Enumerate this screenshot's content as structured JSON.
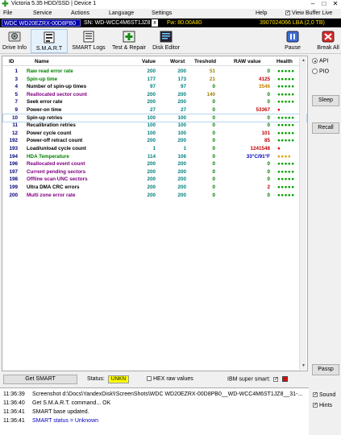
{
  "titlebar": {
    "title": "Victoria 5.35 HDD/SSD | Device 1",
    "icon": "green-cross-icon",
    "controls": [
      "–",
      "□",
      "✕"
    ]
  },
  "menu": {
    "items": [
      "File",
      "Service",
      "Actions",
      "Language",
      "Settings",
      "Help"
    ],
    "view_buffer_live": "View Buffer Live",
    "view_buffer_checked": true
  },
  "infobar": {
    "model": "WDC WD20EZRX-00D8PB0",
    "serial": "SN: WD-WCC4M6ST1JZ8",
    "close": "x",
    "firmware": "Fw: 80.00A80",
    "lba": "3907024066 LBA (2,0 TB)"
  },
  "toolbar": {
    "drive_info": "Drive Info",
    "smart": "S.M.A.R.T",
    "smart_logs": "SMART Logs",
    "test_repair": "Test & Repair",
    "disk_editor": "Disk Editor",
    "pause": "Pause",
    "break_all": "Break All"
  },
  "smart_table": {
    "headers": [
      "ID",
      "Name",
      "Value",
      "Worst",
      "Treshold",
      "RAW value",
      "Health"
    ],
    "rows": [
      {
        "id": "1",
        "name": "Raw read error rate",
        "value": "200",
        "worst": "200",
        "threshold": "51",
        "raw": "0",
        "health": "●●●●●",
        "name_color": "#008000",
        "raw_color": "#008000",
        "health_color": "#00a000"
      },
      {
        "id": "3",
        "name": "Spin-up time",
        "value": "177",
        "worst": "173",
        "threshold": "21",
        "raw": "4125",
        "health": "●●●●●",
        "name_color": "#008000",
        "raw_color": "#c00000",
        "health_color": "#00a000"
      },
      {
        "id": "4",
        "name": "Number of spin-up times",
        "value": "97",
        "worst": "97",
        "threshold": "0",
        "raw": "3546",
        "health": "●●●●●",
        "name_color": "#000000",
        "raw_color": "#c08000",
        "health_color": "#00a000"
      },
      {
        "id": "5",
        "name": "Reallocated sector count",
        "value": "200",
        "worst": "200",
        "threshold": "140",
        "raw": "0",
        "health": "●●●●●",
        "name_color": "#800080",
        "raw_color": "#008000",
        "health_color": "#00a000"
      },
      {
        "id": "7",
        "name": "Seek error rate",
        "value": "200",
        "worst": "200",
        "threshold": "0",
        "raw": "0",
        "health": "●●●●●",
        "name_color": "#000000",
        "raw_color": "#008000",
        "health_color": "#00a000"
      },
      {
        "id": "9",
        "name": "Power-on time",
        "value": "27",
        "worst": "27",
        "threshold": "0",
        "raw": "53367",
        "health": "●",
        "name_color": "#000000",
        "raw_color": "#c00000",
        "health_color": "#e00000"
      },
      {
        "id": "10",
        "name": "Spin-up retries",
        "value": "100",
        "worst": "100",
        "threshold": "0",
        "raw": "0",
        "health": "●●●●●",
        "name_color": "#000000",
        "raw_color": "#008000",
        "health_color": "#00a000"
      },
      {
        "id": "11",
        "name": "Recalibration retries",
        "value": "100",
        "worst": "100",
        "threshold": "0",
        "raw": "0",
        "health": "●●●●●",
        "name_color": "#000000",
        "raw_color": "#008000",
        "health_color": "#00a000"
      },
      {
        "id": "12",
        "name": "Power cycle count",
        "value": "100",
        "worst": "100",
        "threshold": "0",
        "raw": "101",
        "health": "●●●●●",
        "name_color": "#000000",
        "raw_color": "#c00000",
        "health_color": "#00a000"
      },
      {
        "id": "192",
        "name": "Power-off retract count",
        "value": "200",
        "worst": "200",
        "threshold": "0",
        "raw": "85",
        "health": "●●●●●",
        "name_color": "#000000",
        "raw_color": "#c00000",
        "health_color": "#00a000"
      },
      {
        "id": "193",
        "name": "Load/unload cycle count",
        "value": "1",
        "worst": "1",
        "threshold": "0",
        "raw": "1241548",
        "health": "●",
        "name_color": "#000000",
        "raw_color": "#c00000",
        "health_color": "#e00000"
      },
      {
        "id": "194",
        "name": "HDA Temperature",
        "value": "114",
        "worst": "106",
        "threshold": "0",
        "raw": "33°C/91°F",
        "health": "●●●●",
        "name_color": "#008000",
        "raw_color": "#0000c0",
        "health_color": "#e0a000"
      },
      {
        "id": "196",
        "name": "Reallocated event count",
        "value": "200",
        "worst": "200",
        "threshold": "0",
        "raw": "0",
        "health": "●●●●●",
        "name_color": "#800080",
        "raw_color": "#008000",
        "health_color": "#00a000"
      },
      {
        "id": "197",
        "name": "Current pending sectors",
        "value": "200",
        "worst": "200",
        "threshold": "0",
        "raw": "0",
        "health": "●●●●●",
        "name_color": "#800080",
        "raw_color": "#008000",
        "health_color": "#00a000"
      },
      {
        "id": "198",
        "name": "Offline scan UNC sectors",
        "value": "200",
        "worst": "200",
        "threshold": "0",
        "raw": "0",
        "health": "●●●●●",
        "name_color": "#800080",
        "raw_color": "#008000",
        "health_color": "#00a000"
      },
      {
        "id": "199",
        "name": "Ultra DMA CRC errors",
        "value": "200",
        "worst": "200",
        "threshold": "0",
        "raw": "2",
        "health": "●●●●●",
        "name_color": "#000000",
        "raw_color": "#c00000",
        "health_color": "#00a000"
      },
      {
        "id": "200",
        "name": "Multi zone error rate",
        "value": "200",
        "worst": "200",
        "threshold": "0",
        "raw": "0",
        "health": "●●●●●",
        "name_color": "#800080",
        "raw_color": "#008000",
        "health_color": "#00a000"
      }
    ],
    "selected_row": 6
  },
  "right_panel": {
    "api": "API",
    "pio": "PIO",
    "sleep": "Sleep",
    "recall": "Recall",
    "passp": "Passp"
  },
  "status": {
    "get_smart": "Get SMART",
    "status_label": "Status:",
    "status_value": "UNKN",
    "hex_raw": "HEX raw values",
    "ibm_super_smart": "IBM super smart:"
  },
  "log": [
    {
      "time": "11:36:39",
      "text": "Screenshot d:\\Docs\\YandexDisk\\!ScreenShots\\WDC WD20EZRX-00D8PB0__WD-WCC4M6ST1JZ8__31-...",
      "color": "#000000"
    },
    {
      "time": "11:36:40",
      "text": "Get S.M.A.R.T. command... OK",
      "color": "#000000"
    },
    {
      "time": "11:36:41",
      "text": "SMART base updated.",
      "color": "#000000"
    },
    {
      "time": "11:36:41",
      "text": "SMART status = Unknown",
      "color": "#0000c0"
    }
  ],
  "log_options": {
    "sound": "Sound",
    "hints": "Hints"
  },
  "colors": {
    "info_bg": "#000000",
    "model_bg": "#0000a8",
    "info_accent": "#ffe000",
    "status_badge": "#ffff00"
  }
}
